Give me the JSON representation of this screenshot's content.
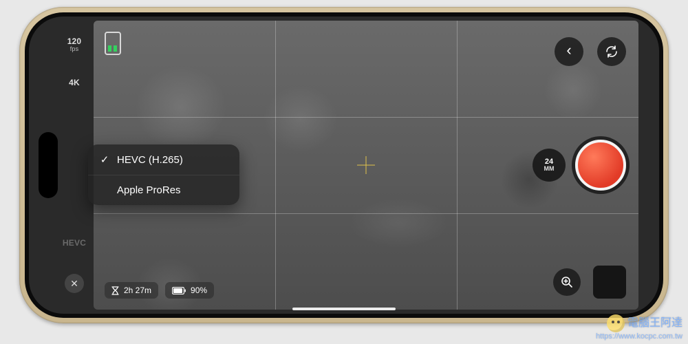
{
  "sidebar": {
    "fps": {
      "top": "120",
      "sub": "fps"
    },
    "res": {
      "label": "4K"
    },
    "codec": {
      "label": "HEVC"
    }
  },
  "meter": {
    "color": "#34d15e"
  },
  "status": {
    "time": "2h 27m",
    "battery": "90%"
  },
  "codec_menu": {
    "selected_index": 0,
    "items": [
      {
        "label": "HEVC (H.265)"
      },
      {
        "label": "Apple ProRes"
      }
    ]
  },
  "lens": {
    "top": "24",
    "sub": "MM"
  },
  "icons": {
    "close": "✕",
    "check": "✓",
    "back_chevron": "‹",
    "zoom_plus": "+"
  },
  "watermark": {
    "text": "電腦王阿達",
    "url": "https://www.kocpc.com.tw"
  }
}
